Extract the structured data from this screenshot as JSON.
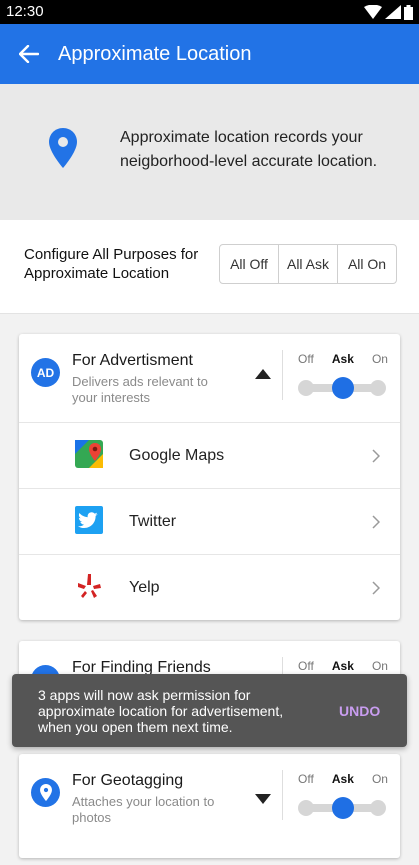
{
  "status_bar": {
    "time": "12:30"
  },
  "app_bar": {
    "title": "Approximate Location"
  },
  "banner": {
    "text": "Approximate location records your neigborhood-level accurate location."
  },
  "configure": {
    "label": "Configure All Purposes for Approximate Location",
    "options": [
      "All Off",
      "All Ask",
      "All On"
    ]
  },
  "slider_labels": {
    "off": "Off",
    "ask": "Ask",
    "on": "On"
  },
  "purposes": [
    {
      "badge": "AD",
      "title": "For Advertisment",
      "description": "Delivers ads relevant to your interests",
      "expanded": true,
      "setting": "Ask",
      "apps": [
        {
          "name": "Google Maps",
          "icon": "google-maps-icon"
        },
        {
          "name": "Twitter",
          "icon": "twitter-icon"
        },
        {
          "name": "Yelp",
          "icon": "yelp-icon"
        }
      ]
    },
    {
      "title": "For Finding Friends",
      "setting": "Ask"
    },
    {
      "icon": "location-pin-icon",
      "title": "For Geotagging",
      "description": "Attaches your location to photos",
      "expanded": false,
      "setting": "Ask"
    }
  ],
  "snackbar": {
    "message": "3 apps will now ask permission for approximate location for advertisement, when you open them next time.",
    "action": "UNDO"
  },
  "colors": {
    "primary": "#2273e6",
    "snackbar_action": "#c99df0",
    "snackbar_bg": "#555555"
  }
}
